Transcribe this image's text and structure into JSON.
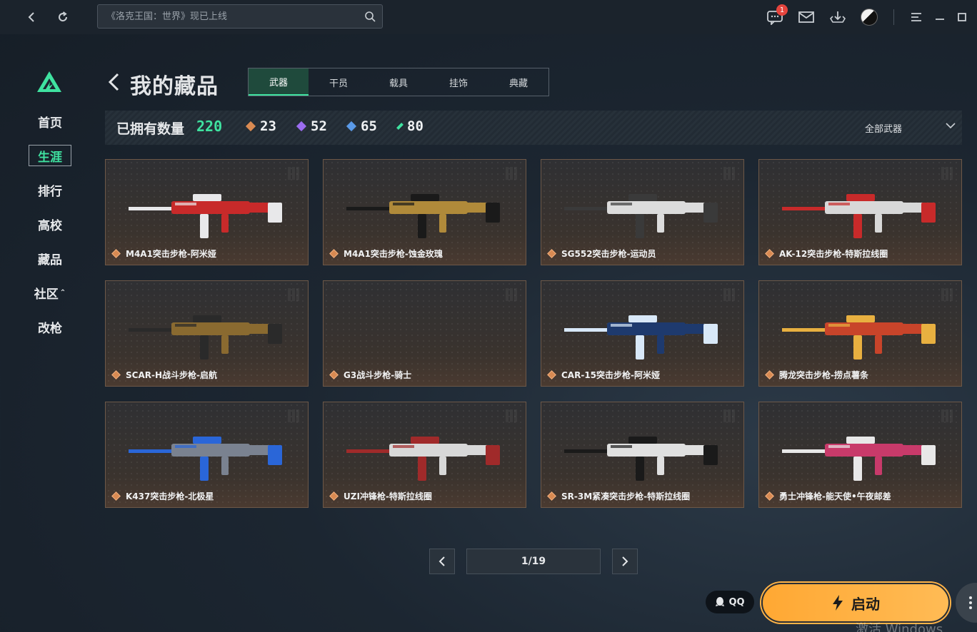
{
  "topbar": {
    "search_placeholder": "《洛克王国：世界》现已上线",
    "message_badge": "1",
    "icons": [
      "back-icon",
      "refresh-icon",
      "search-icon",
      "message-icon",
      "mail-icon",
      "download-icon",
      "avatar",
      "menu-icon",
      "minimize-icon",
      "maximize-icon"
    ]
  },
  "sidebar": {
    "items": [
      {
        "label": "首页"
      },
      {
        "label": "生涯"
      },
      {
        "label": "排行"
      },
      {
        "label": "高校"
      },
      {
        "label": "藏品"
      },
      {
        "label": "社区"
      },
      {
        "label": "改枪"
      }
    ],
    "active": "生涯",
    "accent": "#3fe2a0"
  },
  "header": {
    "title": "我的藏品",
    "tabs": [
      {
        "label": "武器"
      },
      {
        "label": "干员"
      },
      {
        "label": "载具"
      },
      {
        "label": "挂饰"
      },
      {
        "label": "典藏"
      }
    ],
    "active_tab": "武器"
  },
  "summary": {
    "owned_label": "已拥有数量",
    "owned_total": "220",
    "rarities": [
      {
        "count": "23",
        "color": "#d98a52"
      },
      {
        "count": "52",
        "color": "#9b6cf0"
      },
      {
        "count": "65",
        "color": "#5a9ae8"
      },
      {
        "count": "80",
        "color": "#3fe2a0"
      }
    ],
    "filter_label": "全部武器"
  },
  "items": [
    {
      "name": "M4A1突击步枪-阿米娅",
      "color": "#c82a2a",
      "accent": "#e8e8ea"
    },
    {
      "name": "M4A1突击步枪-蚀金玫瑰",
      "color": "#b08a3a",
      "accent": "#1a1a1a"
    },
    {
      "name": "SG552突击步枪-运动员",
      "color": "#dcdcdc",
      "accent": "#3a3a3a"
    },
    {
      "name": "AK-12突击步枪-特斯拉线圈",
      "color": "#d8d8d8",
      "accent": "#c82a2a"
    },
    {
      "name": "SCAR-H战斗步枪-启航",
      "color": "#8a6a30",
      "accent": "#2a2a2a"
    },
    {
      "name": "G3战斗步枪-骑士",
      "color": "",
      "accent": ""
    },
    {
      "name": "CAR-15突击步枪-阿米娅",
      "color": "#1e3a6e",
      "accent": "#d8e8f8"
    },
    {
      "name": "腾龙突击步枪-捞点薯条",
      "color": "#c8442a",
      "accent": "#e8b040"
    },
    {
      "name": "K437突击步枪-北极星",
      "color": "#7a8290",
      "accent": "#2a66d8"
    },
    {
      "name": "UZI冲锋枪-特斯拉线圈",
      "color": "#d8d8d8",
      "accent": "#a02a2a"
    },
    {
      "name": "SR-3M紧凑突击步枪-特斯拉线圈",
      "color": "#e0e0e0",
      "accent": "#1a1a1a"
    },
    {
      "name": "勇士冲锋枪-能天使•午夜邮差",
      "color": "#c83a6a",
      "accent": "#e8e8e8"
    }
  ],
  "pager": {
    "text": "1/19"
  },
  "bottom": {
    "qq_label": "QQ",
    "launch_label": "启动",
    "watermark": "激活 Windows",
    "launch_color": "#ffb347"
  }
}
